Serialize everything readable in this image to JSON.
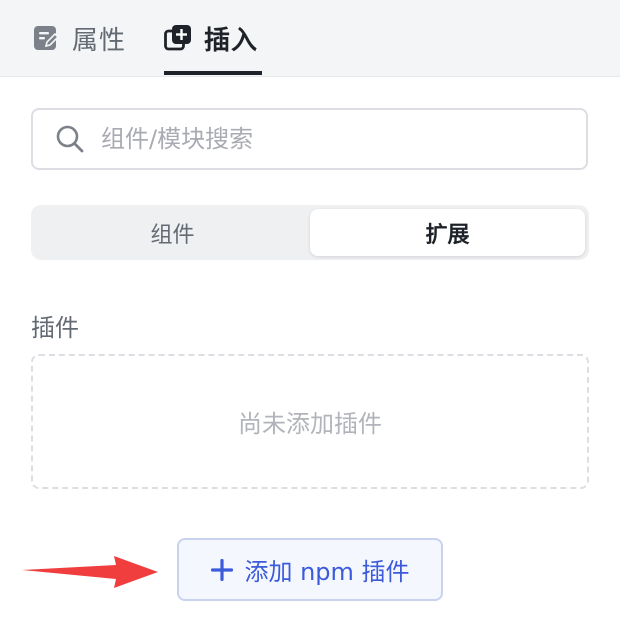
{
  "tabs": {
    "properties": {
      "label": "属性",
      "icon": "edit-note-icon"
    },
    "insert": {
      "label": "插入",
      "icon": "add-layer-icon",
      "active": true
    }
  },
  "search": {
    "placeholder": "组件/模块搜索",
    "value": ""
  },
  "segmented": {
    "items": [
      "组件",
      "扩展"
    ],
    "active_index": 1
  },
  "plugins": {
    "title": "插件",
    "empty_text": "尚未添加插件",
    "add_button": "添加 npm 插件"
  },
  "colors": {
    "accent": "#3b5bdb",
    "annotation_arrow": "#f03e3e"
  }
}
